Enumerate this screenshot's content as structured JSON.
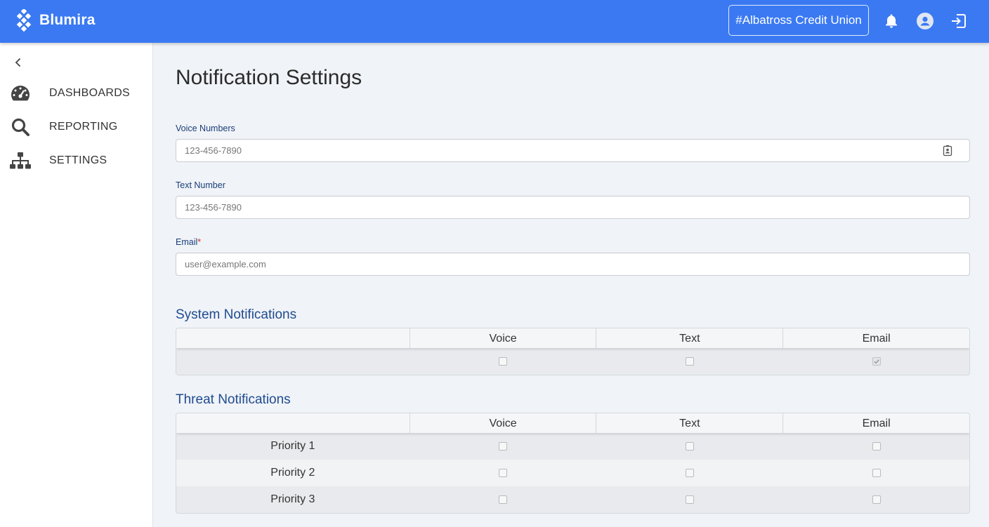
{
  "app": {
    "name": "Blumira",
    "org": "#Albatross Credit Union"
  },
  "colors": {
    "topbar": "#3a79f2",
    "accent_text": "#1f4b8f",
    "required": "#d32f2f"
  },
  "sidebar": {
    "items": [
      {
        "label": "DASHBOARDS",
        "icon": "speedometer-icon"
      },
      {
        "label": "REPORTING",
        "icon": "search-icon"
      },
      {
        "label": "SETTINGS",
        "icon": "sitemap-icon"
      }
    ]
  },
  "page": {
    "title": "Notification Settings"
  },
  "form": {
    "voice": {
      "label": "Voice Numbers",
      "placeholder": "123-456-7890",
      "value": ""
    },
    "text": {
      "label": "Text Number",
      "placeholder": "123-456-7890",
      "value": ""
    },
    "email": {
      "label": "Email",
      "required_mark": "*",
      "placeholder": "user@example.com",
      "value": ""
    }
  },
  "system": {
    "title": "System Notifications",
    "columns": [
      "Voice",
      "Text",
      "Email"
    ],
    "rows": [
      {
        "label": "",
        "voice": false,
        "text": false,
        "email": true,
        "email_disabled": true
      }
    ]
  },
  "threat": {
    "title": "Threat Notifications",
    "columns": [
      "Voice",
      "Text",
      "Email"
    ],
    "rows": [
      {
        "label": "Priority 1",
        "voice": false,
        "text": false,
        "email": false
      },
      {
        "label": "Priority 2",
        "voice": false,
        "text": false,
        "email": false
      },
      {
        "label": "Priority 3",
        "voice": false,
        "text": false,
        "email": false
      }
    ]
  }
}
